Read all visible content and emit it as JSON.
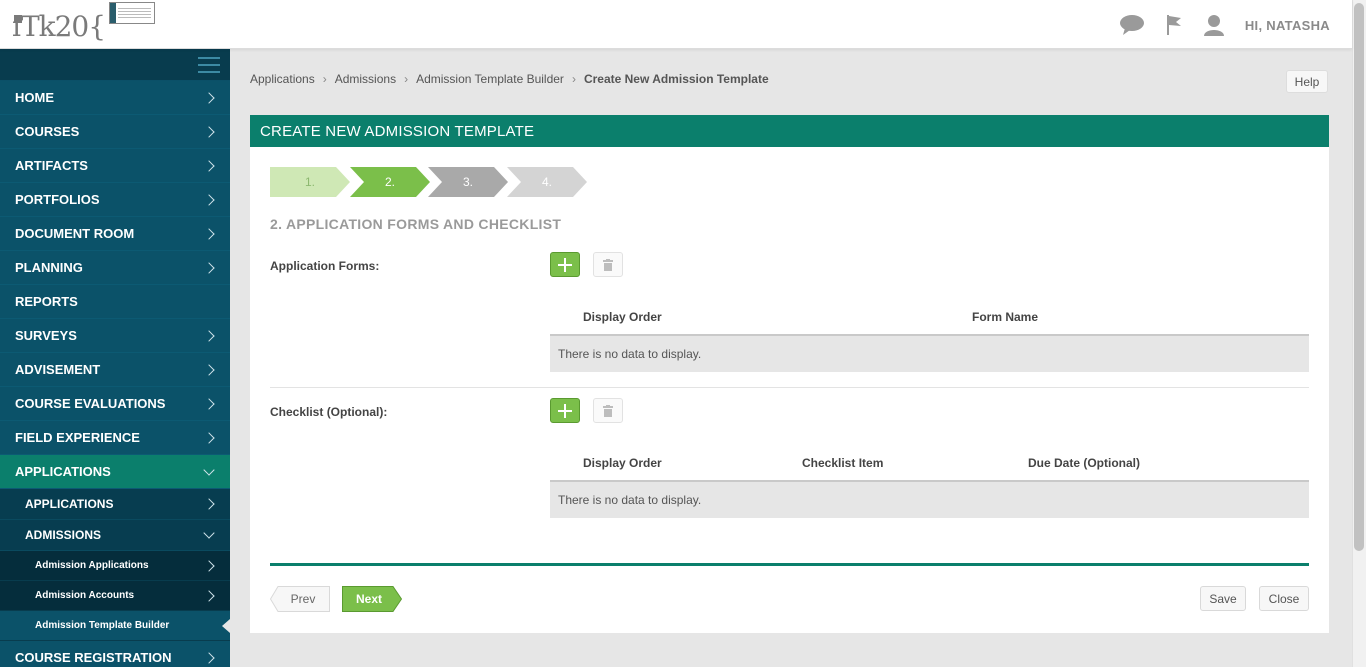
{
  "header": {
    "logo_text": "Tk20",
    "greeting": "HI, NATASHA",
    "icons": [
      "chat-bubble-icon",
      "flag-icon",
      "user-icon"
    ]
  },
  "sidebar": {
    "items": [
      {
        "label": "HOME",
        "level": 0,
        "chevron": "right"
      },
      {
        "label": "COURSES",
        "level": 0,
        "chevron": "right"
      },
      {
        "label": "ARTIFACTS",
        "level": 0,
        "chevron": "right"
      },
      {
        "label": "PORTFOLIOS",
        "level": 0,
        "chevron": "right"
      },
      {
        "label": "DOCUMENT ROOM",
        "level": 0,
        "chevron": "right"
      },
      {
        "label": "PLANNING",
        "level": 0,
        "chevron": "right"
      },
      {
        "label": "REPORTS",
        "level": 0,
        "chevron": "none"
      },
      {
        "label": "SURVEYS",
        "level": 0,
        "chevron": "right"
      },
      {
        "label": "ADVISEMENT",
        "level": 0,
        "chevron": "right"
      },
      {
        "label": "COURSE EVALUATIONS",
        "level": 0,
        "chevron": "right"
      },
      {
        "label": "FIELD EXPERIENCE",
        "level": 0,
        "chevron": "right"
      },
      {
        "label": "APPLICATIONS",
        "level": 0,
        "chevron": "down",
        "active": true
      },
      {
        "label": "APPLICATIONS",
        "level": 1,
        "chevron": "right"
      },
      {
        "label": "ADMISSIONS",
        "level": 1,
        "chevron": "down"
      },
      {
        "label": "Admission Applications",
        "level": 2,
        "chevron": "right"
      },
      {
        "label": "Admission Accounts",
        "level": 2,
        "chevron": "right"
      },
      {
        "label": "Admission Template Builder",
        "level": 2,
        "chevron": "none",
        "current": true
      },
      {
        "label": "COURSE REGISTRATION",
        "level": 0,
        "chevron": "right"
      }
    ]
  },
  "breadcrumb": {
    "items": [
      "Applications",
      "Admissions",
      "Admission Template Builder"
    ],
    "current": "Create New Admission Template"
  },
  "help_label": "Help",
  "panel": {
    "title": "CREATE NEW ADMISSION TEMPLATE",
    "steps": [
      {
        "label": "1.",
        "state": "done",
        "color": "#cfe8b5"
      },
      {
        "label": "2.",
        "state": "current",
        "color": "#7bbf4a"
      },
      {
        "label": "3.",
        "state": "next",
        "color": "#a9a9a9"
      },
      {
        "label": "4.",
        "state": "upcoming",
        "color": "#d4d4d4"
      }
    ],
    "section_title": "2. APPLICATION FORMS AND CHECKLIST",
    "forms": {
      "label": "Application Forms:",
      "columns": [
        "Display Order",
        "Form Name"
      ],
      "empty_text": "There is no data to display."
    },
    "checklist": {
      "label": "Checklist (Optional):",
      "columns": [
        "Display Order",
        "Checklist Item",
        "Due Date (Optional)"
      ],
      "empty_text": "There is no data to display."
    },
    "buttons": {
      "prev": "Prev",
      "next": "Next",
      "save": "Save",
      "close": "Close"
    }
  },
  "colors": {
    "brand_teal": "#0b7f6c",
    "sidebar_bg": "#0b5269",
    "accent_green": "#7bbf4a"
  }
}
